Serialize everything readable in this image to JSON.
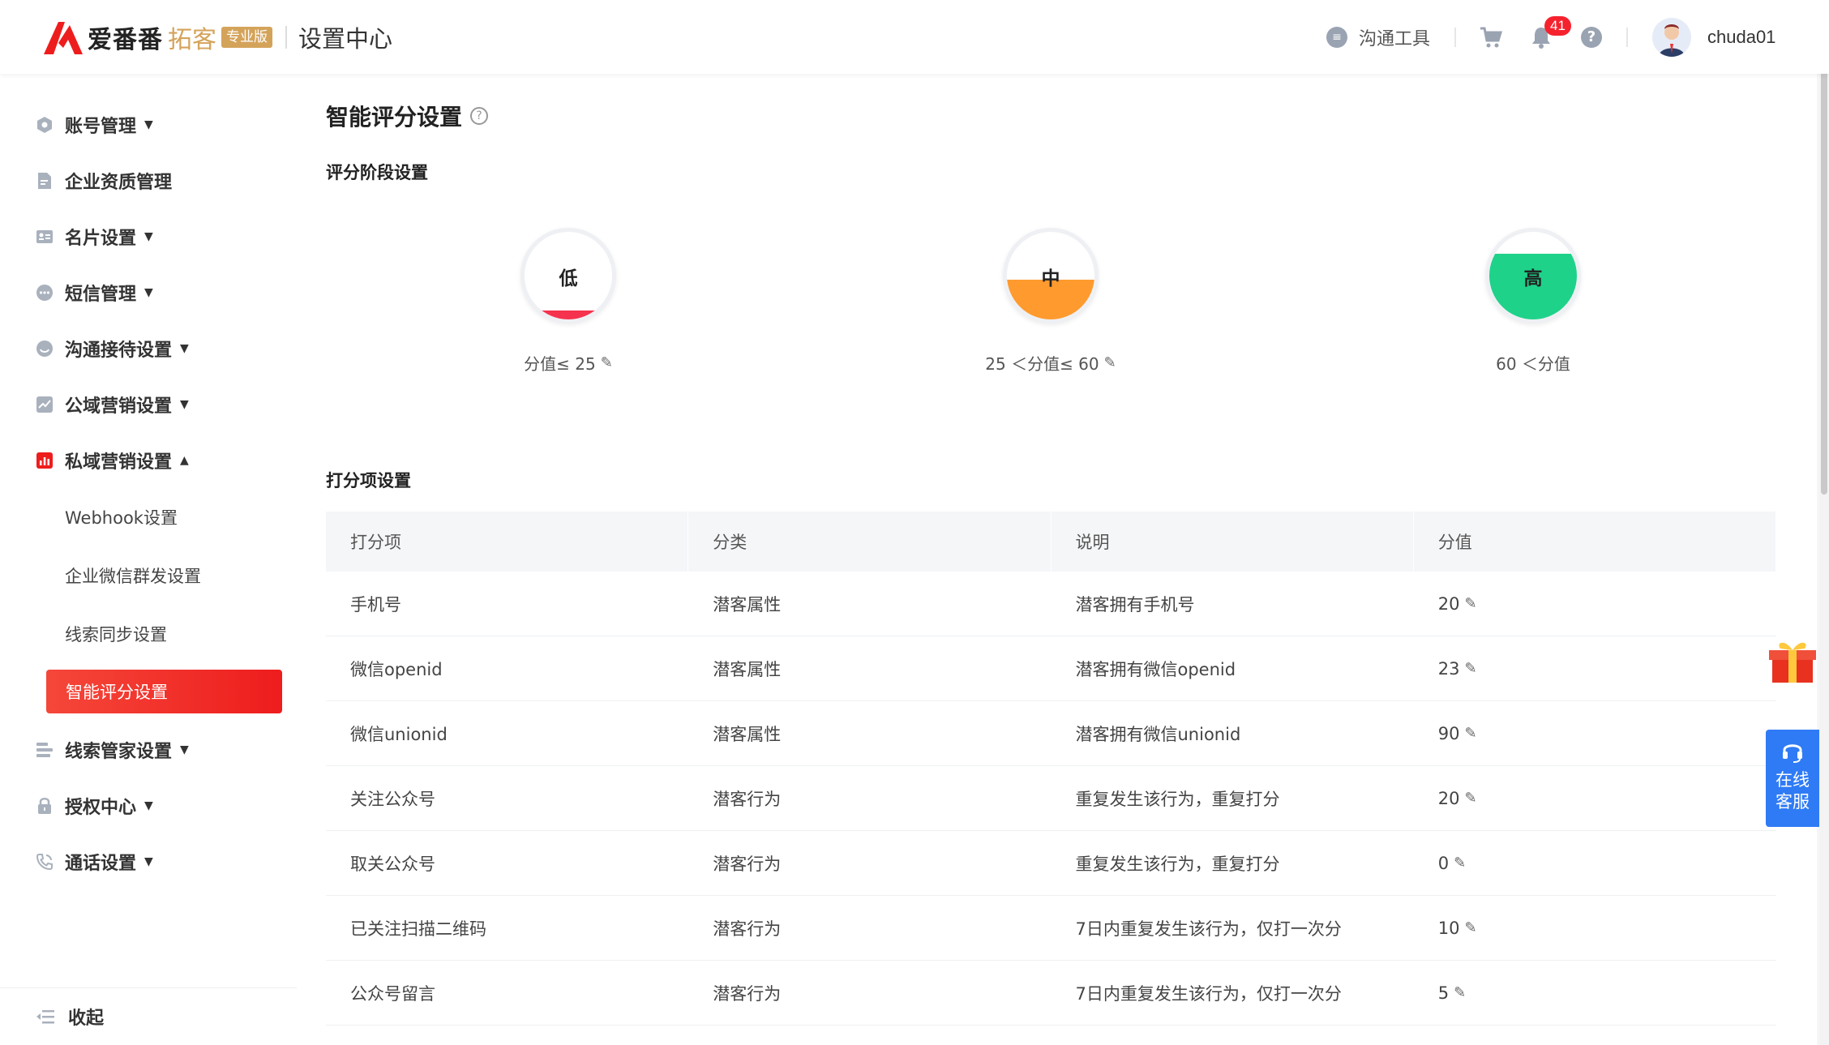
{
  "header": {
    "brand_main": "爱番番",
    "brand_sub": "拓客",
    "brand_badge": "专业版",
    "title": "设置中心",
    "tool_label": "沟通工具",
    "notification_count": "41",
    "username": "chuda01"
  },
  "sidebar": {
    "items": [
      {
        "label": "账号管理",
        "icon": "hexagon-icon",
        "expandable": true
      },
      {
        "label": "企业资质管理",
        "icon": "document-icon",
        "expandable": false
      },
      {
        "label": "名片设置",
        "icon": "card-icon",
        "expandable": true
      },
      {
        "label": "短信管理",
        "icon": "chat-icon",
        "expandable": true
      },
      {
        "label": "沟通接待设置",
        "icon": "smile-icon",
        "expandable": true
      },
      {
        "label": "公域营销设置",
        "icon": "trend-icon",
        "expandable": true
      },
      {
        "label": "私域营销设置",
        "icon": "bar-chart-icon",
        "expandable": true
      },
      {
        "label": "线索管家设置",
        "icon": "list-icon",
        "expandable": true
      },
      {
        "label": "授权中心",
        "icon": "lock-icon",
        "expandable": true
      },
      {
        "label": "通话设置",
        "icon": "phone-icon",
        "expandable": true
      }
    ],
    "sub_items": [
      "Webhook设置",
      "企业微信群发设置",
      "线索同步设置",
      "智能评分设置"
    ],
    "collapse_label": "收起"
  },
  "main": {
    "page_title": "智能评分设置",
    "stage_section_title": "评分阶段设置",
    "stages": [
      {
        "label": "低",
        "range": "分值≤ 25",
        "editable": true,
        "color": "#f5334f",
        "fill": 0.1
      },
      {
        "label": "中",
        "range": "25 ＜分值≤ 60",
        "editable": true,
        "color": "#ff9a2e",
        "fill": 0.45
      },
      {
        "label": "高",
        "range": "60 ＜分值",
        "editable": false,
        "color": "#1ed28a",
        "fill": 0.75
      }
    ],
    "score_section_title": "打分项设置",
    "table": {
      "headers": [
        "打分项",
        "分类",
        "说明",
        "分值"
      ],
      "rows": [
        {
          "item": "手机号",
          "category": "潜客属性",
          "desc": "潜客拥有手机号",
          "score": "20"
        },
        {
          "item": "微信openid",
          "category": "潜客属性",
          "desc": "潜客拥有微信openid",
          "score": "23"
        },
        {
          "item": "微信unionid",
          "category": "潜客属性",
          "desc": "潜客拥有微信unionid",
          "score": "90"
        },
        {
          "item": "关注公众号",
          "category": "潜客行为",
          "desc": "重复发生该行为，重复打分",
          "score": "20"
        },
        {
          "item": "取关公众号",
          "category": "潜客行为",
          "desc": "重复发生该行为，重复打分",
          "score": "0"
        },
        {
          "item": "已关注扫描二维码",
          "category": "潜客行为",
          "desc": "7日内重复发生该行为，仅打一次分",
          "score": "10"
        },
        {
          "item": "公众号留言",
          "category": "潜客行为",
          "desc": "7日内重复发生该行为，仅打一次分",
          "score": "5"
        }
      ]
    }
  },
  "floaters": {
    "service_line1": "在线",
    "service_line2": "客服"
  },
  "colors": {
    "accent_red": "#ee1d1d",
    "brand_gold": "#d4a35a",
    "service_blue": "#2f7bf5"
  }
}
